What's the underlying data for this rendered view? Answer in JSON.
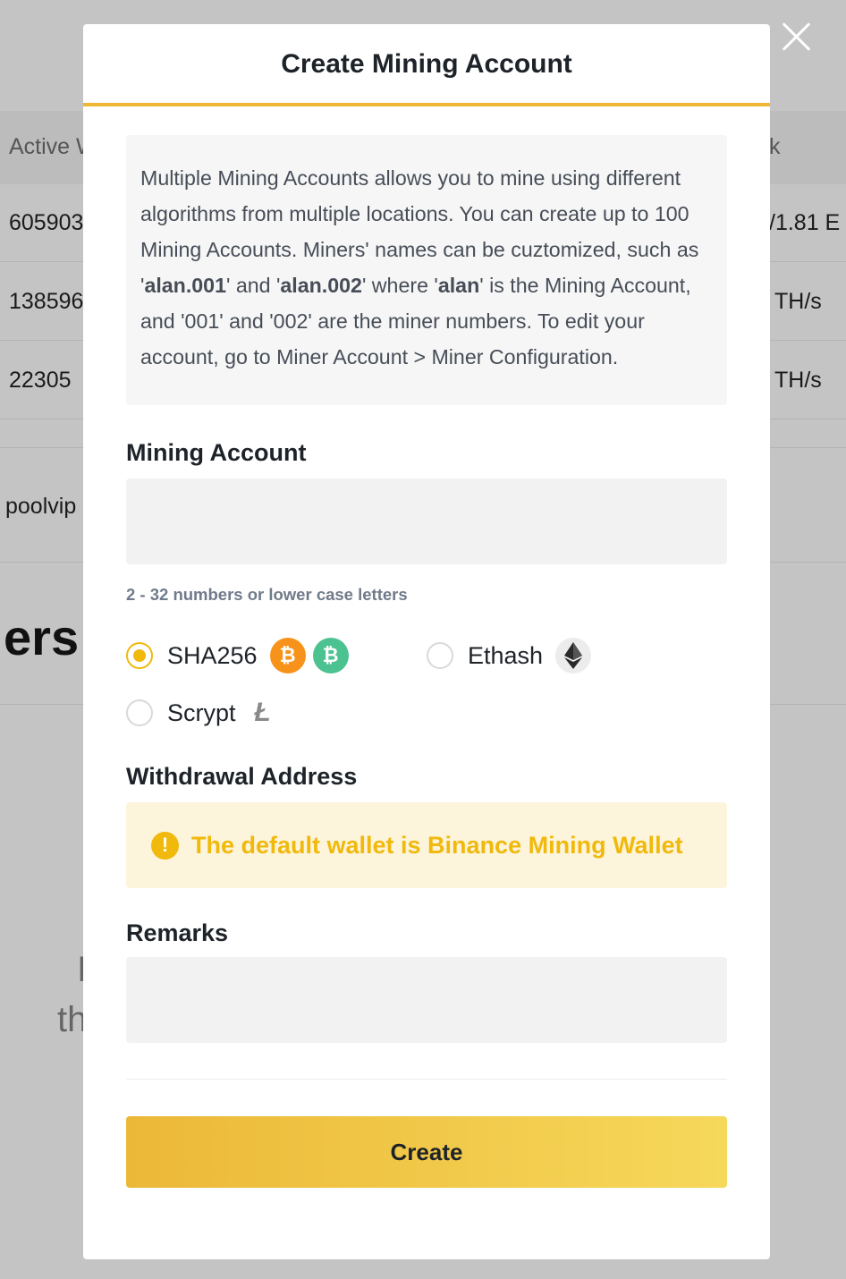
{
  "background": {
    "header_col1": "Active W",
    "header_col2": "k",
    "rows": [
      {
        "left": "605903",
        "right": "/1.81 E"
      },
      {
        "left": "138596",
        "right": "TH/s"
      },
      {
        "left": "22305",
        "right": "TH/s"
      }
    ],
    "poolvip": "poolvip",
    "heading_fragment": "ers",
    "frag_1": "I",
    "frag_2": "th"
  },
  "modal": {
    "title": "Create Mining Account",
    "close_icon": "close-icon",
    "info": {
      "p1": "Multiple Mining Accounts allows you to mine using different algorithms from multiple locations. You can create up to 100 Mining Accounts. Miners' names can be cuztomized, such as '",
      "ex1": "alan.001",
      "p2": "' and '",
      "ex2": "alan.002",
      "p3": "' where '",
      "ex3": "alan",
      "p4": "' is the Mining Account, and '001' and '002' are the miner numbers. To edit your account, go to Miner Account > Miner Configuration."
    },
    "mining_account": {
      "label": "Mining Account",
      "value": "",
      "hint": "2 - 32 numbers or lower case letters"
    },
    "algorithms": [
      {
        "label": "SHA256",
        "selected": true,
        "icons": [
          "bitcoin-icon",
          "bitcoin-cash-icon"
        ]
      },
      {
        "label": "Ethash",
        "selected": false,
        "icons": [
          "ethereum-icon"
        ]
      },
      {
        "label": "Scrypt",
        "selected": false,
        "icons": [
          "litecoin-icon"
        ]
      }
    ],
    "coin_glyphs": {
      "btc": "₿",
      "bch": "₿",
      "ltc": "Ł"
    },
    "withdrawal": {
      "label": "Withdrawal Address",
      "warning": "The default wallet is Binance Mining Wallet",
      "warning_icon": "!"
    },
    "remarks": {
      "label": "Remarks",
      "value": ""
    },
    "create_label": "Create",
    "accent_color": "#f0b90b"
  }
}
